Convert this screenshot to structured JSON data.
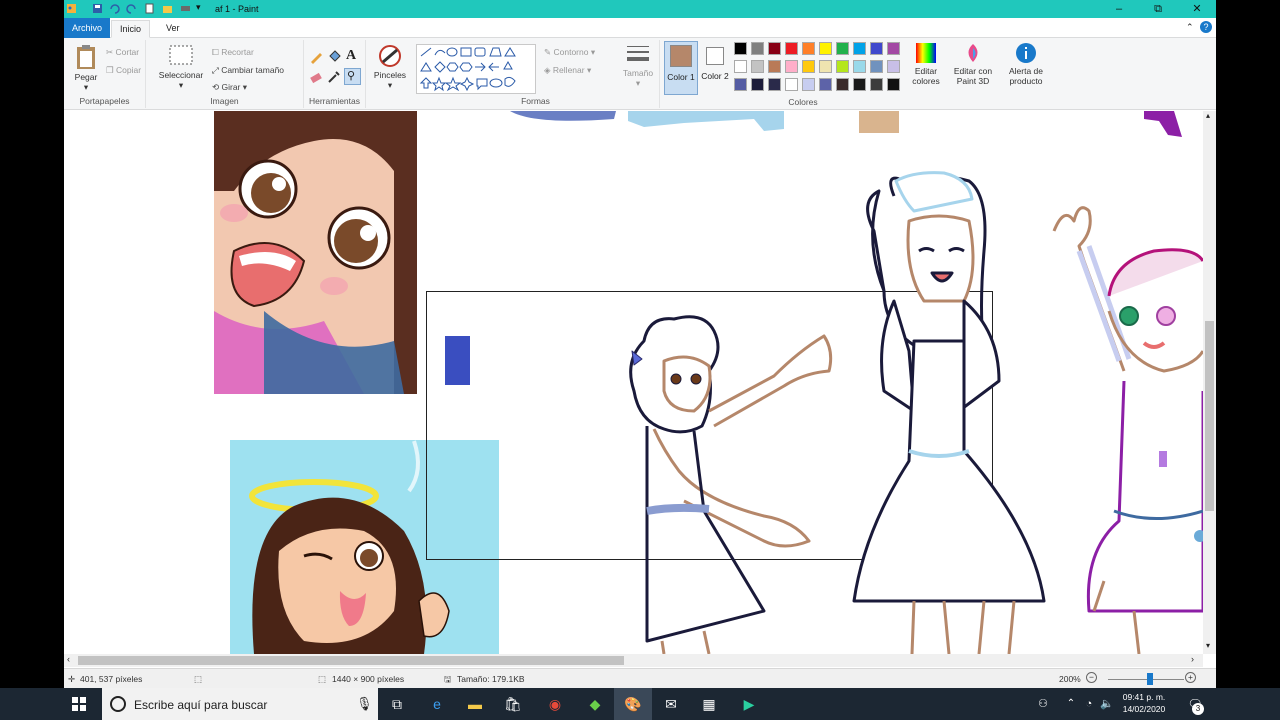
{
  "window": {
    "title": "af 1 - Paint",
    "minimize": "–",
    "maximize": "⧉",
    "close": "✕"
  },
  "tabs": {
    "archivo": "Archivo",
    "inicio": "Inicio",
    "ver": "Ver"
  },
  "ribbon": {
    "portapapeles": {
      "label": "Portapapeles",
      "pegar": "Pegar",
      "cortar": "Cortar",
      "copiar": "Copiar"
    },
    "imagen": {
      "label": "Imagen",
      "seleccionar": "Seleccionar",
      "recortar": "Recortar",
      "cambiar_tamano": "Cambiar tamaño",
      "girar": "Girar"
    },
    "herramientas": {
      "label": "Herramientas"
    },
    "pinceles": {
      "label": "Pinceles"
    },
    "formas": {
      "label": "Formas",
      "contorno": "Contorno",
      "rellenar": "Rellenar"
    },
    "tamano": {
      "label": "Tamaño"
    },
    "color1": {
      "label": "Color 1",
      "value": "#b5876a"
    },
    "color2": {
      "label": "Color 2",
      "value": "#ffffff"
    },
    "colores": {
      "label": "Colores",
      "row1": [
        "#000000",
        "#7f7f7f",
        "#880015",
        "#ed1c24",
        "#ff7f27",
        "#fff200",
        "#22b14c",
        "#00a2e8",
        "#3f48cc",
        "#a349a4"
      ],
      "row2": [
        "#ffffff",
        "#c3c3c3",
        "#b97a57",
        "#ffaec9",
        "#ffc90e",
        "#efe4b0",
        "#b5e61d",
        "#99d9ea",
        "#7092be",
        "#c8bfe7"
      ],
      "row3": [
        "#545ca3",
        "#1c1c3a",
        "#2a2a4a",
        "#ffffff",
        "#c7cdf0",
        "#5d63a8",
        "#3a2a2a",
        "#1a1a1a",
        "#3c3c3c",
        "#111111"
      ]
    },
    "editar_colores": "Editar colores",
    "editar_paint3d": "Editar con Paint 3D",
    "alerta": "Alerta de producto"
  },
  "status": {
    "cursor": "401, 537 píxeles",
    "dimensions": "1440 × 900 píxeles",
    "size": "Tamaño: 179.1KB",
    "zoom": "200%"
  },
  "taskbar": {
    "search_placeholder": "Escribe aquí para buscar",
    "time": "09:41 p. m.",
    "date": "14/02/2020",
    "notifications": "3"
  }
}
